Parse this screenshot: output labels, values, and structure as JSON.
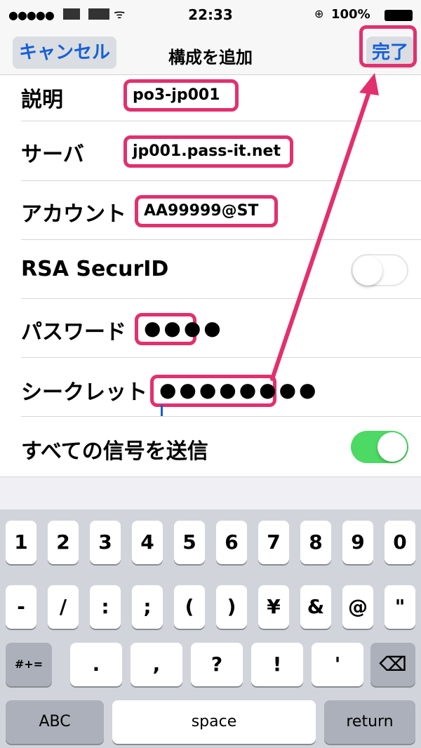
{
  "status_bar": {
    "signal": "●●●●●",
    "time": "22:33",
    "lock_icon": "⊕",
    "battery": "100%"
  },
  "nav": {
    "cancel_label": "キャンセル",
    "title": "構成を追加",
    "done_label": "完了"
  },
  "form": {
    "description": {
      "label": "説明",
      "value": "po3-jp001"
    },
    "server": {
      "label": "サーバ",
      "value": "jp001.pass-it.net"
    },
    "account": {
      "label": "アカウント",
      "value": "AA99999@ST"
    },
    "rsa": {
      "label": "RSA SecurID",
      "enabled": false
    },
    "password": {
      "label": "パスワード",
      "value": "●●●●"
    },
    "secret": {
      "label": "シークレット",
      "value": "●●●●●●●●"
    },
    "send_all": {
      "label": "すべての信号を送信",
      "enabled": true
    }
  },
  "keyboard": {
    "row1": [
      "1",
      "2",
      "3",
      "4",
      "5",
      "6",
      "7",
      "8",
      "9",
      "0"
    ],
    "row2": [
      "-",
      "/",
      ":",
      ";",
      "(",
      ")",
      "¥",
      "&",
      "@",
      "\""
    ],
    "row3_left": "#+=",
    "row3": [
      ".",
      ",",
      "?",
      "!",
      "'"
    ],
    "backspace_icon": "⌫",
    "abc": "ABC",
    "space": "space",
    "return": "return"
  },
  "colors": {
    "accent": "#1560d6",
    "highlight": "#e2306e",
    "toggle_on": "#4cd964"
  }
}
